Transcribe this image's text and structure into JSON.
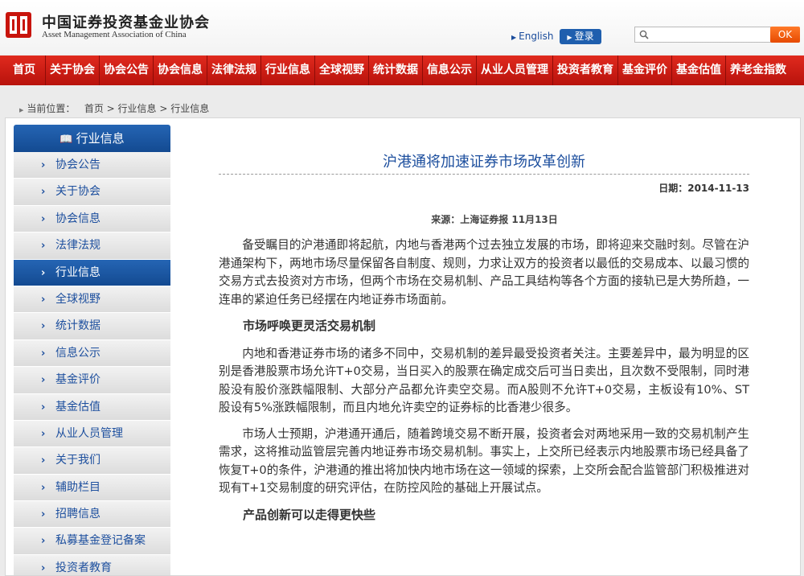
{
  "header": {
    "logo_cn": "中国证券投资基金业协会",
    "logo_en": "Asset Management Association of China",
    "lang_link": "English",
    "login": "登录",
    "search_placeholder": "",
    "ok": "OK",
    "brand_color": "#c8140c"
  },
  "nav": [
    "首页",
    "关于协会",
    "协会公告",
    "协会信息",
    "法律法规",
    "行业信息",
    "全球视野",
    "统计数据",
    "信息公示",
    "从业人员管理",
    "投资者教育",
    "基金评价",
    "基金估值",
    "养老金指数"
  ],
  "breadcrumb": {
    "label": "当前位置：",
    "path": "首页 > 行业信息 > 行业信息"
  },
  "sidebar": {
    "title": "行业信息",
    "items": [
      "协会公告",
      "关于协会",
      "协会信息",
      "法律法规",
      "行业信息",
      "全球视野",
      "统计数据",
      "信息公示",
      "基金评价",
      "基金估值",
      "从业人员管理",
      "关于我们",
      "辅助栏目",
      "招聘信息",
      "私募基金登记备案",
      "投资者教育"
    ],
    "active_index": 4
  },
  "article": {
    "title": "沪港通将加速证券市场改革创新",
    "date_label": "日期：",
    "date": "2014-11-13",
    "source": "来源：上海证券报  11月13日",
    "p1": "备受瞩目的沪港通即将起航，内地与香港两个过去独立发展的市场，即将迎来交融时刻。尽管在沪港通架构下，两地市场尽量保留各自制度、规则，力求让双方的投资者以最低的交易成本、以最习惯的交易方式去投资对方市场，但两个市场在交易机制、产品工具结构等各个方面的接轨已是大势所趋，一连串的紧迫任务已经摆在内地证券市场面前。",
    "h1": "市场呼唤更灵活交易机制",
    "p2": "内地和香港证券市场的诸多不同中，交易机制的差异最受投资者关注。主要差异中，最为明显的区别是香港股票市场允许T+0交易，当日买入的股票在确定成交后可当日卖出，且次数不受限制，同时港股没有股价涨跌幅限制、大部分产品都允许卖空交易。而A股则不允许T+0交易，主板设有10%、ST股设有5%涨跌幅限制，而且内地允许卖空的证券标的比香港少很多。",
    "p3": "市场人士预期，沪港通开通后，随着跨境交易不断开展，投资者会对两地采用一致的交易机制产生需求，这将推动监管层完善内地证券市场交易机制。事实上，上交所已经表示内地股票市场已经具备了恢复T+0的条件，沪港通的推出将加快内地市场在这一领域的探索，上交所会配合监管部门积极推进对现有T+1交易制度的研究评估，在防控风险的基础上开展试点。",
    "h2": "产品创新可以走得更快些"
  }
}
